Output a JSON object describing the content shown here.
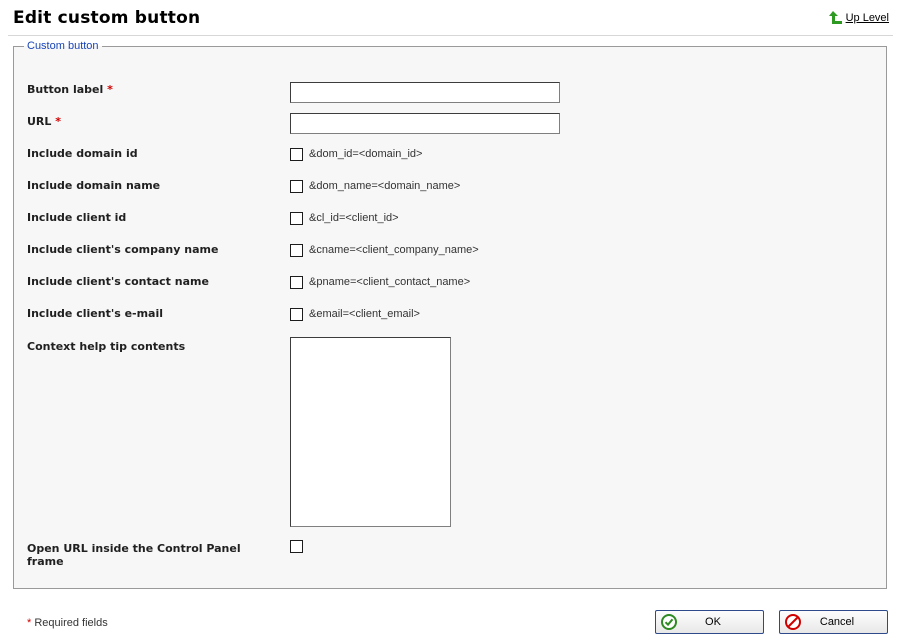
{
  "header": {
    "title": "Edit custom button",
    "up_level": "Up Level"
  },
  "form": {
    "legend": "Custom button",
    "required_mark": "*",
    "fields": {
      "button_label": {
        "label": "Button label",
        "value": ""
      },
      "url": {
        "label": "URL",
        "value": ""
      },
      "include_domain_id": {
        "label": "Include domain id",
        "text": "&dom_id=<domain_id>"
      },
      "include_domain_name": {
        "label": "Include domain name",
        "text": "&dom_name=<domain_name>"
      },
      "include_client_id": {
        "label": "Include client id",
        "text": "&cl_id=<client_id>"
      },
      "include_company_name": {
        "label": "Include client's company name",
        "text": "&cname=<client_company_name>"
      },
      "include_contact_name": {
        "label": "Include client's contact name",
        "text": "&pname=<client_contact_name>"
      },
      "include_email": {
        "label": "Include client's e-mail",
        "text": "&email=<client_email>"
      },
      "context_help": {
        "label": "Context help tip contents",
        "value": ""
      },
      "open_inside": {
        "label": "Open URL inside the Control Panel frame"
      }
    }
  },
  "footer": {
    "required_note": "Required fields",
    "ok_label": "OK",
    "cancel_label": "Cancel"
  },
  "colors": {
    "accent": "#1a44b8",
    "required": "#d00000",
    "up_arrow": "#2e9a22"
  }
}
